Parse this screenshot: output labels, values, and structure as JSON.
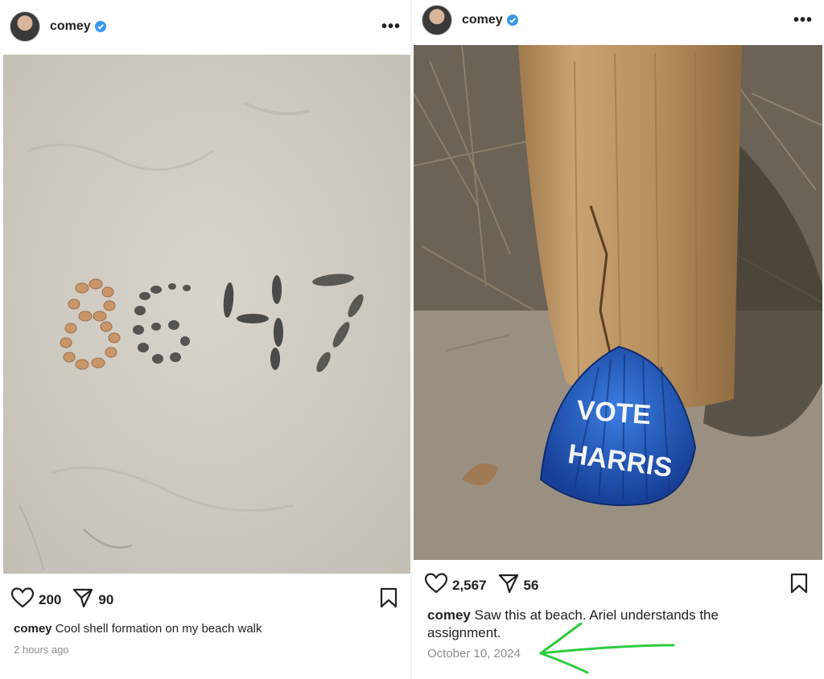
{
  "posts": [
    {
      "username": "comey",
      "likes": "200",
      "shares": "90",
      "caption_user": "comey",
      "caption_text": "Cool shell formation on my beach walk",
      "timestamp": "2 hours ago",
      "photo_text": "8647"
    },
    {
      "username": "comey",
      "likes": "2,567",
      "shares": "56",
      "caption_user": "comey",
      "caption_text": "Saw this at beach. Ariel understands the assignment.",
      "timestamp": "October 10, 2024",
      "photo_text": "VOTE HARRIS"
    }
  ],
  "colors": {
    "verified": "#3897f0",
    "annotation_arrow": "#2ecc40",
    "shell_blue": "#1f5fc9"
  },
  "icons": [
    "verified-icon",
    "more-icon",
    "heart-icon",
    "share-icon",
    "bookmark-icon"
  ]
}
